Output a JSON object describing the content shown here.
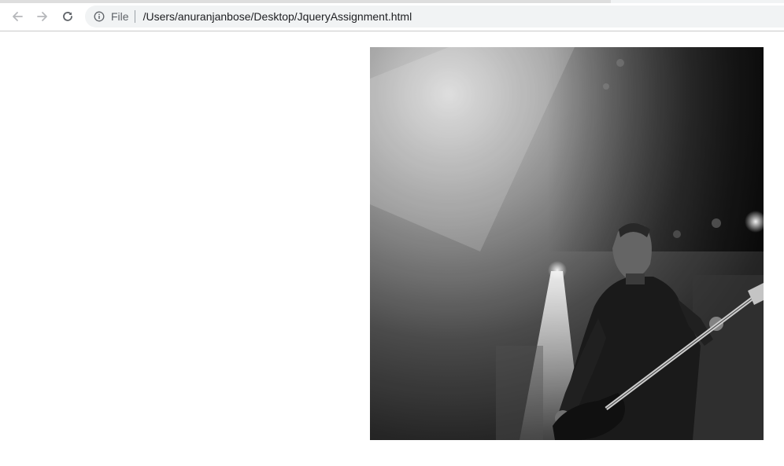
{
  "browser": {
    "scheme_label": "File",
    "url": "/Users/anuranjanbose/Desktop/JqueryAssignment.html",
    "icons": {
      "back": "arrow-left",
      "forward": "arrow-right",
      "reload": "reload",
      "info": "info-circle"
    }
  },
  "page": {
    "image": {
      "subject": "black-and-white concert photo: bassist playing guitar under stage lights",
      "tone": "grayscale"
    }
  }
}
